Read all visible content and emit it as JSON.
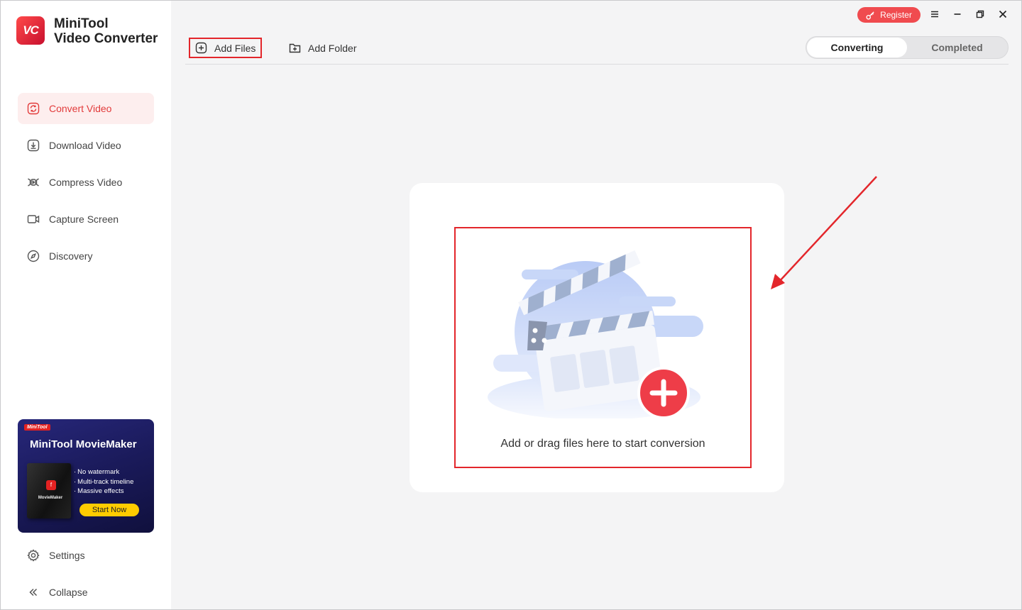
{
  "app": {
    "brand_line1": "MiniTool",
    "brand_line2": "Video Converter",
    "logo_text": "VC"
  },
  "sidebar": {
    "items": [
      {
        "label": "Convert Video",
        "icon": "convert-icon",
        "active": true
      },
      {
        "label": "Download Video",
        "icon": "download-icon",
        "active": false
      },
      {
        "label": "Compress Video",
        "icon": "compress-icon",
        "active": false
      },
      {
        "label": "Capture Screen",
        "icon": "camera-icon",
        "active": false
      },
      {
        "label": "Discovery",
        "icon": "compass-icon",
        "active": false
      }
    ],
    "settings_label": "Settings",
    "collapse_label": "Collapse"
  },
  "promo": {
    "brand": "MiniTool",
    "title": "MiniTool MovieMaker",
    "box_label": "MovieMaker",
    "features": [
      "No watermark",
      "Multi-track timeline",
      "Massive effects"
    ],
    "cta": "Start Now"
  },
  "toolbar": {
    "add_files": "Add Files",
    "add_folder": "Add Folder"
  },
  "tabs": {
    "converting": "Converting",
    "completed": "Completed"
  },
  "titlebar": {
    "register": "Register"
  },
  "dropzone": {
    "text": "Add or drag files here to start conversion"
  },
  "colors": {
    "accent": "#e23b3b",
    "register": "#f04b4f",
    "promo_cta": "#ffcc00"
  }
}
